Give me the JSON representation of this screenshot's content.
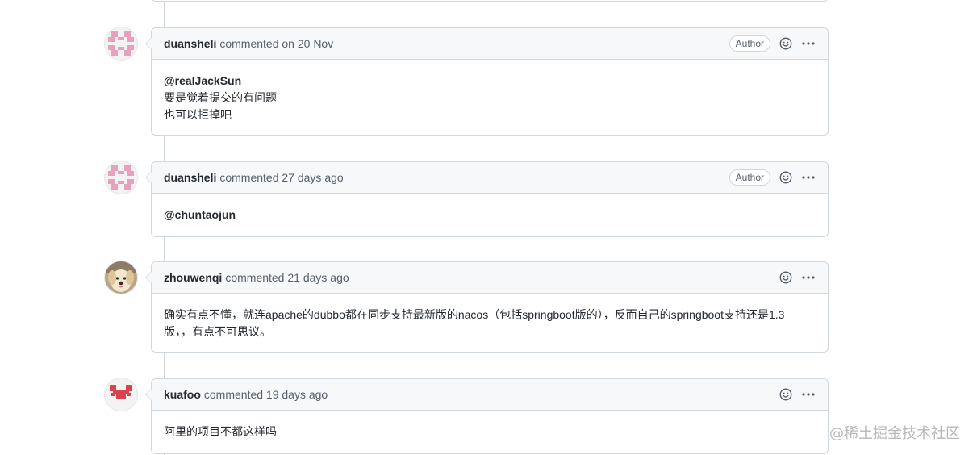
{
  "comments": [
    {
      "author": "duansheli",
      "meta": "commented on 20 Nov",
      "badge": "Author",
      "mention": "@realJackSun",
      "lines": [
        "要是觉着提交的有问题",
        "也可以拒掉吧"
      ]
    },
    {
      "author": "duansheli",
      "meta": "commented 27 days ago",
      "badge": "Author",
      "mention": "@chuntaojun",
      "lines": []
    },
    {
      "author": "zhouwenqi",
      "meta": "commented 21 days ago",
      "badge": "",
      "mention": "",
      "lines": [
        "确实有点不懂，就连apache的dubbo都在同步支持最新版的nacos（包括springboot版的），反而自己的springboot支持还是1.3",
        "版，，有点不可思议。"
      ]
    },
    {
      "author": "kuafoo",
      "meta": "commented 19 days ago",
      "badge": "",
      "mention": "",
      "lines": [
        "阿里的项目不都这样吗"
      ]
    }
  ],
  "icons": {
    "reaction": "smiley-icon",
    "more": "kebab-horizontal-icon"
  },
  "colors": {
    "identicon_pink": "#e8a0bf",
    "identicon_red": "#d9434e",
    "border": "#d0d7de",
    "header_bg": "#f6f8fa"
  },
  "watermark": "@稀土掘金技术社区"
}
